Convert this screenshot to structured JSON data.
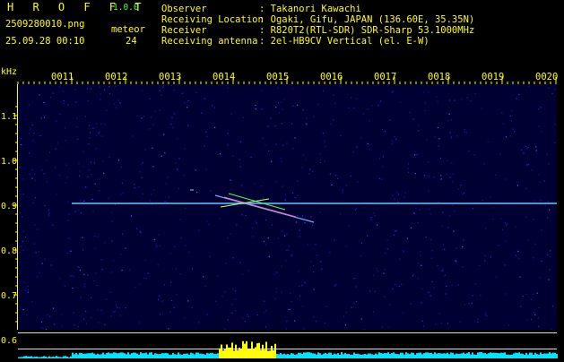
{
  "app": {
    "name": "H R O F F T",
    "version": "1.0.0"
  },
  "file": {
    "name": "2509280010.png",
    "datetime": "25.09.28 00:10"
  },
  "meteor": {
    "label": "meteor",
    "count": "24"
  },
  "info": [
    {
      "label": "Observer",
      "value": ": Takanori Kawachi"
    },
    {
      "label": "Receiving Location",
      "value": ": Ogaki, Gifu, JAPAN (136.60E, 35.35N)"
    },
    {
      "label": "Receiver",
      "value": ": R820T2(RTL-SDR) SDR-Sharp 53.1000MHz"
    },
    {
      "label": "Receiving antenna",
      "value": ": 2el-HB9CV Vertical (el. E-W)"
    }
  ],
  "plot": {
    "y_unit": "kHz",
    "y_ticks": [
      "1.1",
      "1.0",
      "0.9",
      "0.8",
      "0.7",
      "0.6"
    ],
    "x_ticks": [
      "0011",
      "0012",
      "0013",
      "0014",
      "0015",
      "0016",
      "0017",
      "0018",
      "0019",
      "0020"
    ],
    "carrier_khz": 0.905,
    "colors": {
      "background": "#000033",
      "text": "#ffff00",
      "carrier": "#5fc8ff",
      "level": "#00e5ff",
      "burst": "#ffff00"
    }
  }
}
